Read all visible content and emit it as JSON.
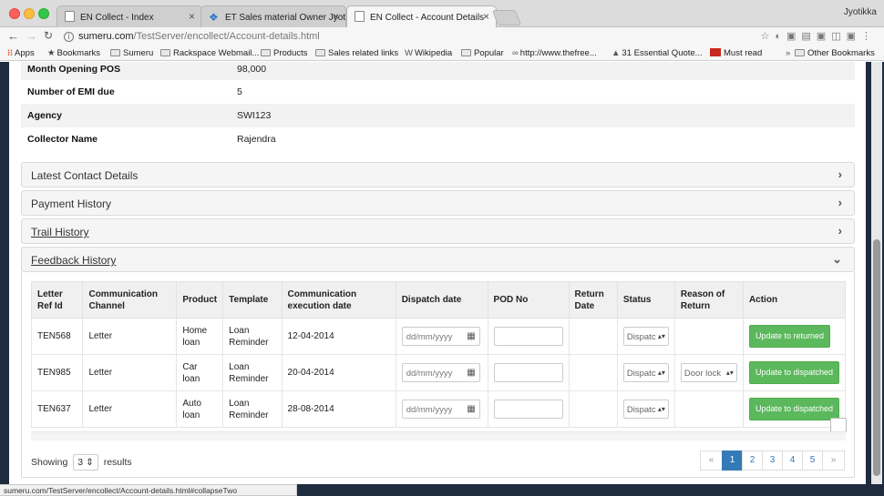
{
  "browser": {
    "tabs": [
      {
        "title": "EN Collect - Index",
        "active": false,
        "icon": "page-icon"
      },
      {
        "title": "ET Sales material Owner Jyoti",
        "active": false,
        "icon": "dropbox-icon"
      },
      {
        "title": "EN Collect - Account Details",
        "active": true,
        "icon": "page-icon"
      }
    ],
    "profile_name": "Jyotikka",
    "url_host": "sumeru.com",
    "url_path": "/TestServer/encollect/Account-details.html",
    "bookmarks": [
      "Apps",
      "Bookmarks",
      "Sumeru",
      "Rackspace Webmail...",
      "Products",
      "Sales related links",
      "Wikipedia",
      "Popular",
      "http://www.thefree...",
      "31 Essential Quote...",
      "Must read"
    ],
    "other_bookmarks": "Other Bookmarks",
    "status_url": "sumeru.com/TestServer/encollect/Account-details.html#collapseTwo"
  },
  "details": [
    {
      "label": "Month Opening POS",
      "value": "98,000"
    },
    {
      "label": "Number of EMI due",
      "value": "5"
    },
    {
      "label": "Agency",
      "value": "SWI123"
    },
    {
      "label": "Collector Name",
      "value": "Rajendra"
    }
  ],
  "accordion": {
    "latest_contact": "Latest Contact Details",
    "payment_history": "Payment History",
    "trail_history": "Trail History",
    "feedback_history": "Feedback History"
  },
  "feedback": {
    "headers": {
      "ref": "Letter Ref Id",
      "channel": "Communication Channel",
      "product": "Product",
      "template": "Template",
      "exec_date": "Communication execution date",
      "dispatch": "Dispatch date",
      "pod": "POD No",
      "return_date": "Return Date",
      "status": "Status",
      "reason": "Reason of Return",
      "action": "Action"
    },
    "date_placeholder": "dd/mm/yyyy",
    "rows": [
      {
        "ref": "TEN568",
        "channel": "Letter",
        "product": "Home loan",
        "template": "Loan Reminder",
        "exec_date": "12-04-2014",
        "status": "Dispatc",
        "reason": "",
        "action": "Update to returned"
      },
      {
        "ref": "TEN985",
        "channel": "Letter",
        "product": "Car loan",
        "template": "Loan Reminder",
        "exec_date": "20-04-2014",
        "status": "Dispatc",
        "reason": "Door lock",
        "action": "Update to dispatched"
      },
      {
        "ref": "TEN637",
        "channel": "Letter",
        "product": "Auto loan",
        "template": "Loan Reminder",
        "exec_date": "28-08-2014",
        "status": "Dispatc",
        "reason": "",
        "action": "Update to dispatched"
      }
    ]
  },
  "paging": {
    "showing_label": "Showing",
    "page_size": "3",
    "results_label": "results",
    "prev": "«",
    "pages": [
      "1",
      "2",
      "3",
      "4",
      "5"
    ],
    "next": "»",
    "current_page": "1"
  }
}
